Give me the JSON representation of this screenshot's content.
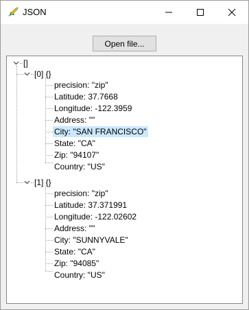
{
  "window": {
    "title": "JSON",
    "icon": "rocket-app-icon",
    "controls": {
      "minimize": "minimize-icon",
      "maximize": "maximize-icon",
      "close": "close-icon"
    }
  },
  "toolbar": {
    "open_label": "Open file..."
  },
  "tree": {
    "root_label": "[]",
    "items": [
      {
        "label": "[0] {}",
        "fields": [
          "precision: \"zip\"",
          "Latitude: 37.7668",
          "Longitude: -122.3959",
          "Address: \"\"",
          "City: \"SAN FRANCISCO\"",
          "State: \"CA\"",
          "Zip: \"94107\"",
          "Country: \"US\""
        ]
      },
      {
        "label": "[1] {}",
        "fields": [
          "precision: \"zip\"",
          "Latitude: 37.371991",
          "Longitude: -122.02602",
          "Address: \"\"",
          "City: \"SUNNYVALE\"",
          "State: \"CA\"",
          "Zip: \"94085\"",
          "Country: \"US\""
        ]
      }
    ],
    "selected": "City: \"SAN FRANCISCO\""
  },
  "colors": {
    "selection": "#cce8ff",
    "border": "#828790"
  }
}
